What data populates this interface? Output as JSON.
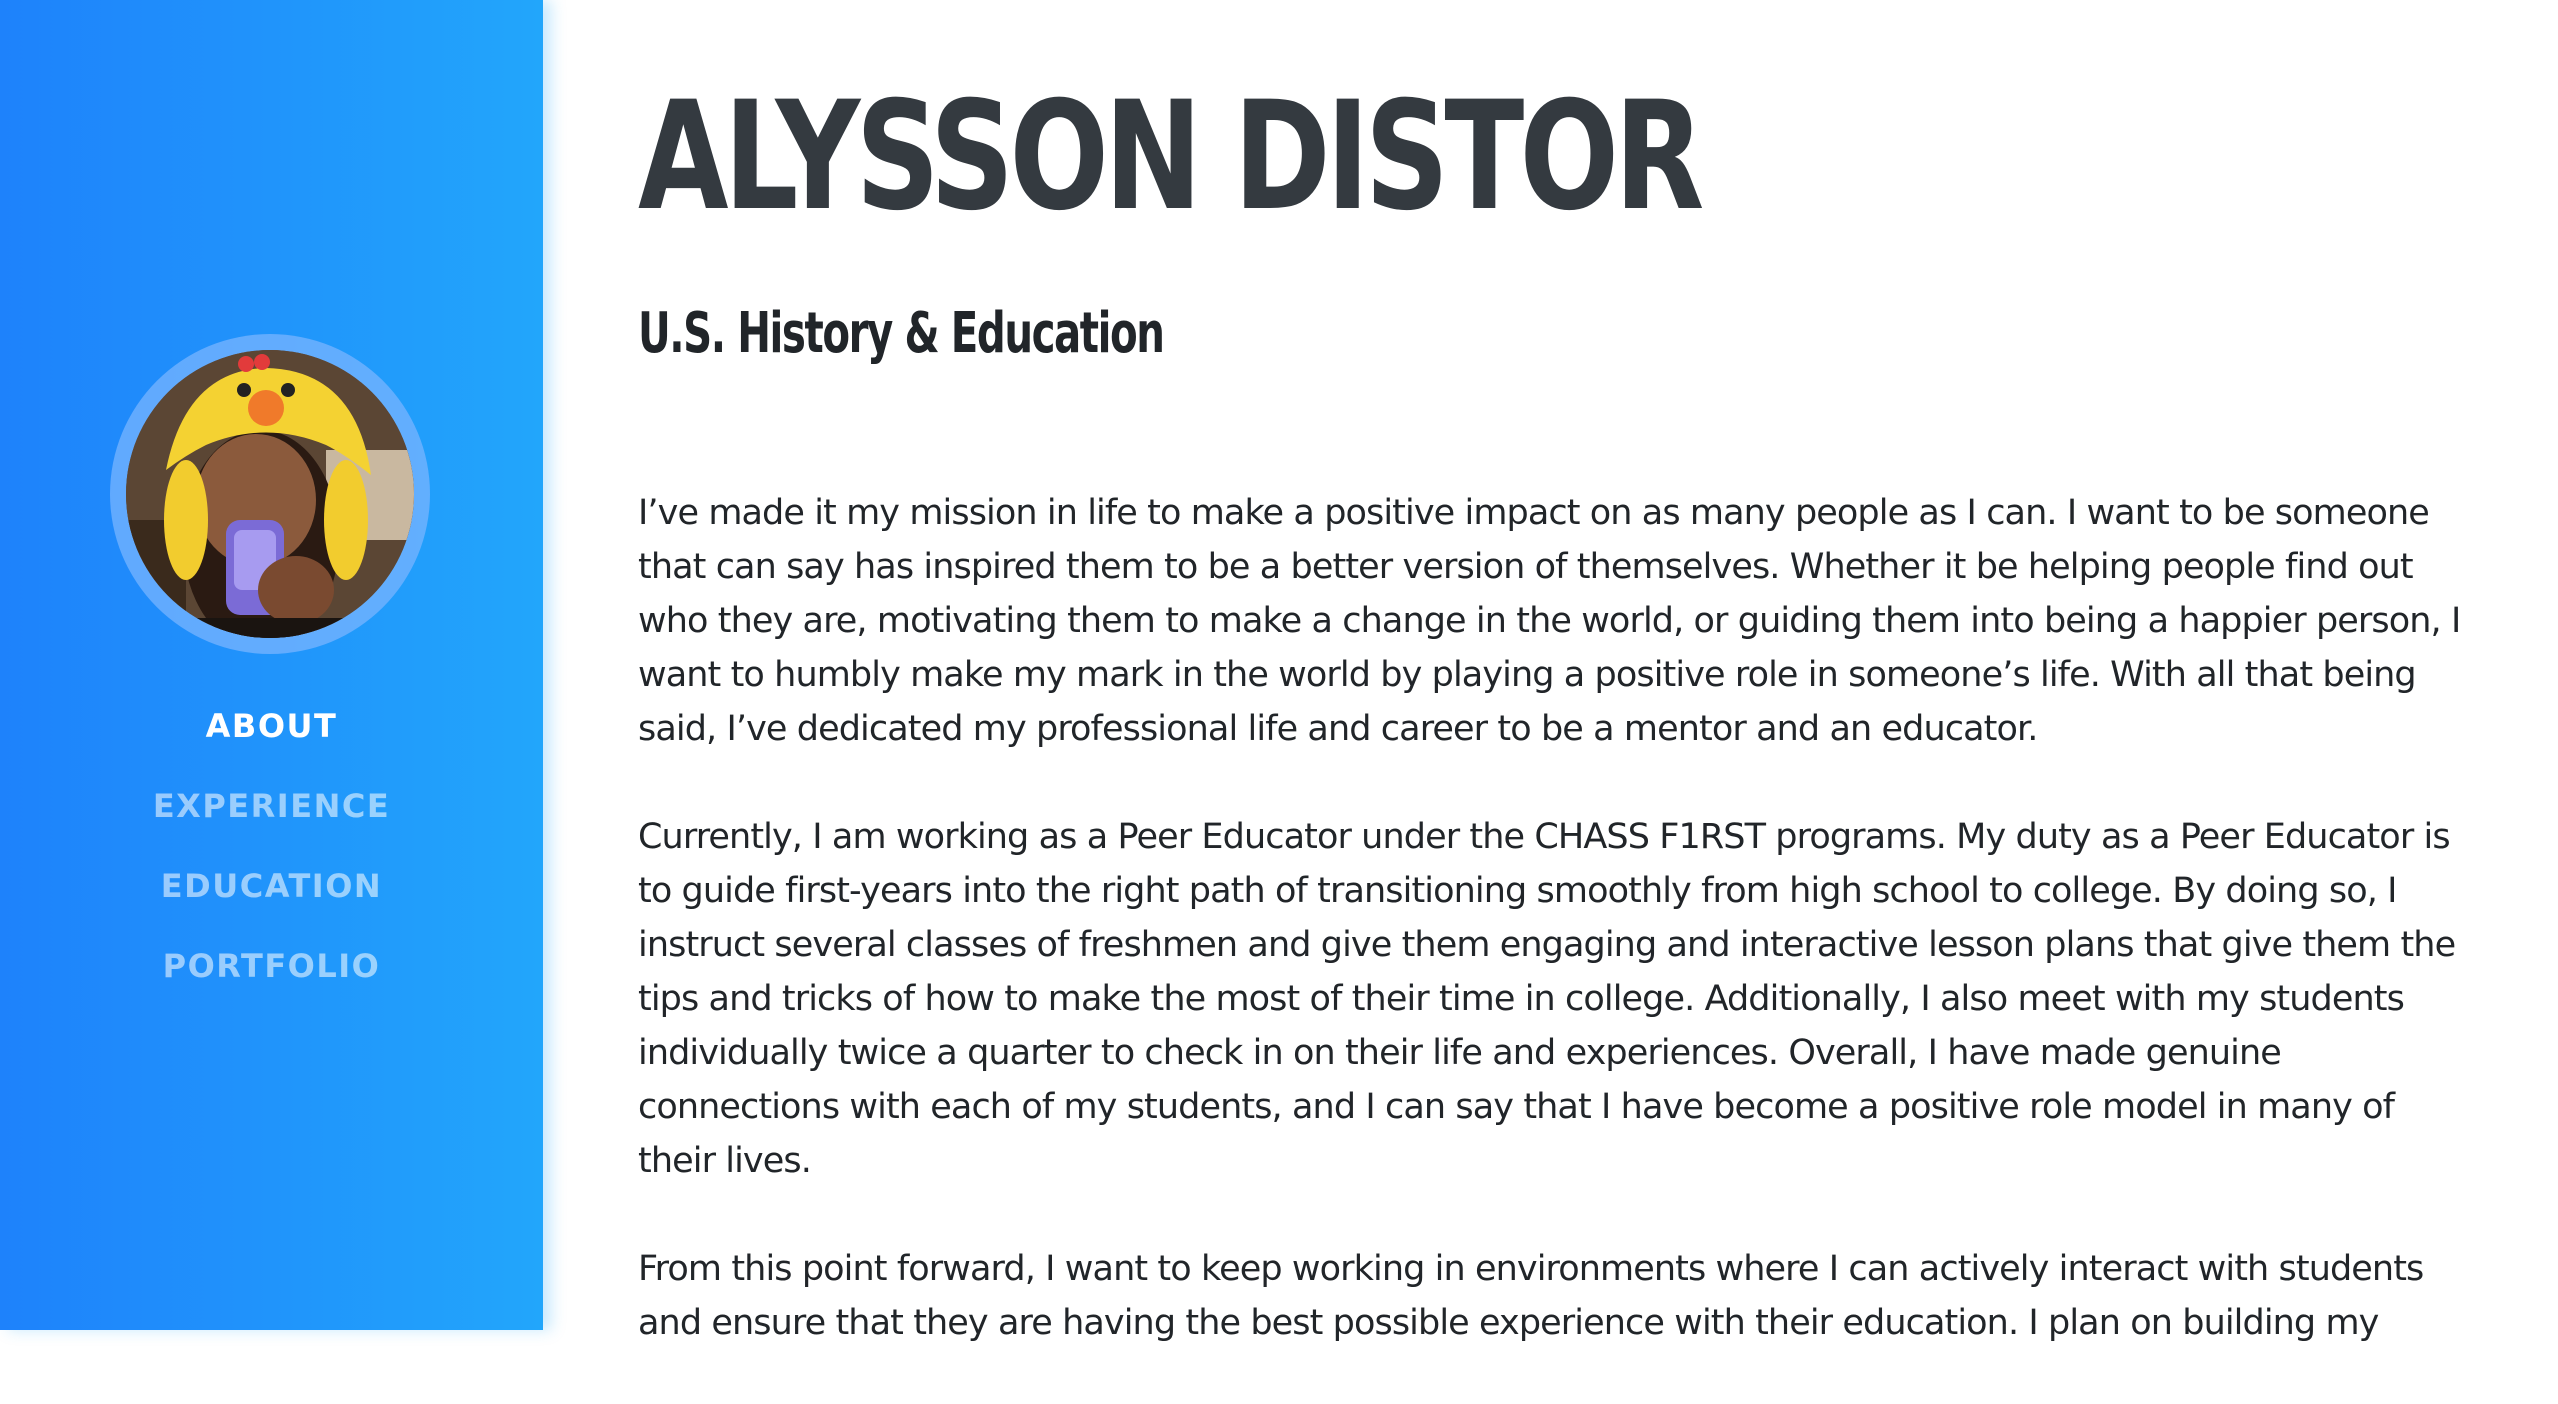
{
  "sidebar": {
    "avatar_alt": "profile photo",
    "nav": [
      {
        "label": "ABOUT",
        "active": true
      },
      {
        "label": "EXPERIENCE",
        "active": false
      },
      {
        "label": "EDUCATION",
        "active": false
      },
      {
        "label": "PORTFOLIO",
        "active": false
      }
    ]
  },
  "main": {
    "name": "ALYSSON DISTOR",
    "subtitle": "U.S. History & Education",
    "paragraphs": [
      "I’ve made it my mission in life to make a positive impact on as many people as I can. I want to be someone that can say has inspired them to be a better version of themselves. Whether it be helping people find out who they are, motivating them to make a change in the world, or guiding them into being a happier person, I want to humbly make my mark in the world by playing a positive role in someone’s life. With all that being said, I’ve dedicated my professional life and career to be a mentor and an educator.",
      "Currently, I am working as a Peer Educator under the CHASS F1RST programs. My duty as a Peer Educator is to guide first-years into the right path of transitioning smoothly from high school to college. By doing so, I instruct several classes of freshmen and give them engaging and interactive lesson plans that give them the tips and tricks of how to make the most of their time in college. Additionally, I also meet with my students individually twice a quarter to check in on their life and experiences. Overall, I have made genuine connections with each of my students, and I can say that I have become a positive role model in many of their lives.",
      "From this point forward, I want to keep working in environments where I can actively interact with students and ensure that they are having the best possible experience with their education. I plan on building my"
    ]
  },
  "colors": {
    "sidebar_start": "#1e82fb",
    "sidebar_end": "#22a6fb",
    "heading": "#343a40",
    "text": "#212529"
  }
}
